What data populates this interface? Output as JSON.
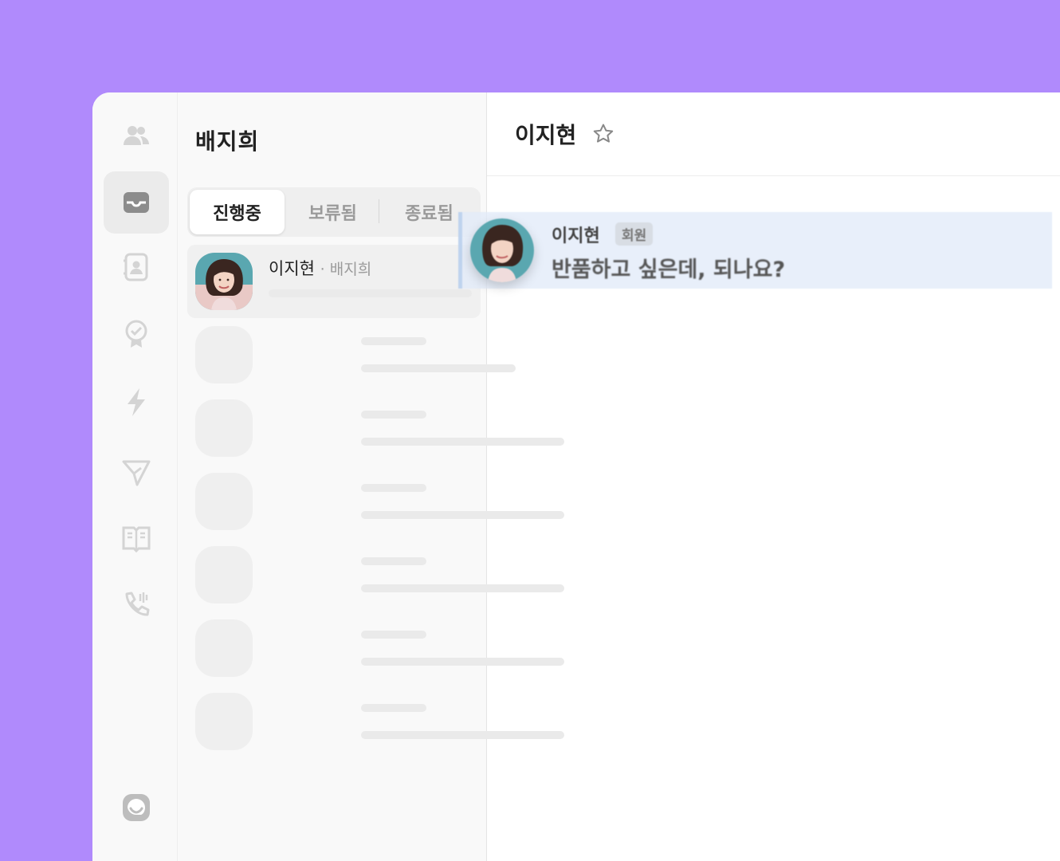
{
  "sidebar": {
    "icons": [
      "people-icon",
      "inbox-icon",
      "contact-card-icon",
      "badge-icon",
      "lightning-icon",
      "send-icon",
      "book-icon",
      "phone-icon",
      "chat-logo-icon"
    ],
    "active_index": 1
  },
  "chat_list": {
    "title": "배지희",
    "tabs": [
      {
        "label": "진행중",
        "active": true
      },
      {
        "label": "보류됨",
        "active": false
      },
      {
        "label": "종료됨",
        "active": false
      }
    ],
    "items": [
      {
        "name": "이지현",
        "assignee": "· 배지희"
      }
    ],
    "placeholder_count": 6
  },
  "conversation": {
    "title": "이지현",
    "star_icon": "star-icon",
    "message": {
      "sender": "이지현",
      "badge": "회원",
      "text": "반품하고 싶은데, 되나요?"
    }
  },
  "colors": {
    "background": "#b08afc",
    "message_highlight": "#e2ebf8"
  }
}
